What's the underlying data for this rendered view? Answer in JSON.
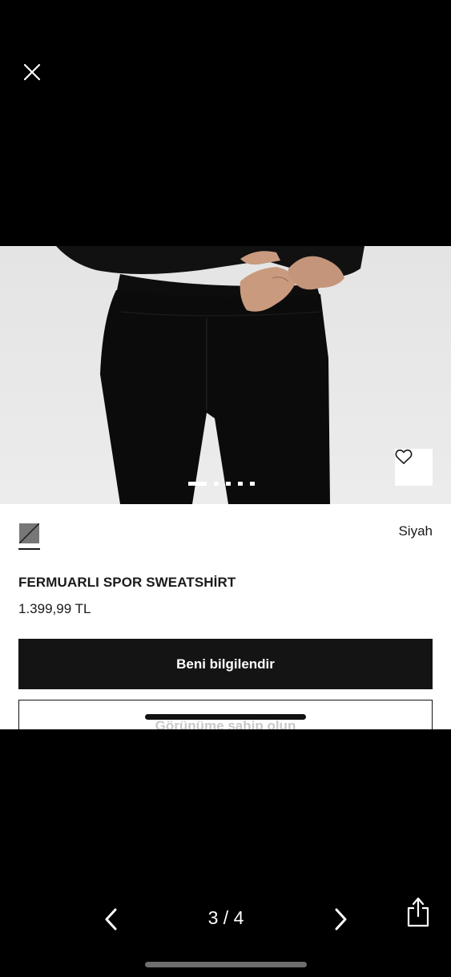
{
  "viewer": {
    "counter": "3 / 4"
  },
  "icons": {
    "close": "close-icon",
    "favorite": "heart-icon",
    "prev": "chevron-left-icon",
    "next": "chevron-right-icon",
    "share": "share-icon"
  },
  "carousel": {
    "total": 5,
    "active_index": 0
  },
  "product": {
    "color_name": "Siyah",
    "title": "FERMUARLI SPOR SWEATSHİRT",
    "price": "1.399,99 TL",
    "notify_button": "Beni bilgilendir",
    "secondary_button": "Görünüme sahip olun"
  },
  "colors": {
    "background": "#000000",
    "primary_button": "#141414",
    "swatch": "#777777"
  }
}
